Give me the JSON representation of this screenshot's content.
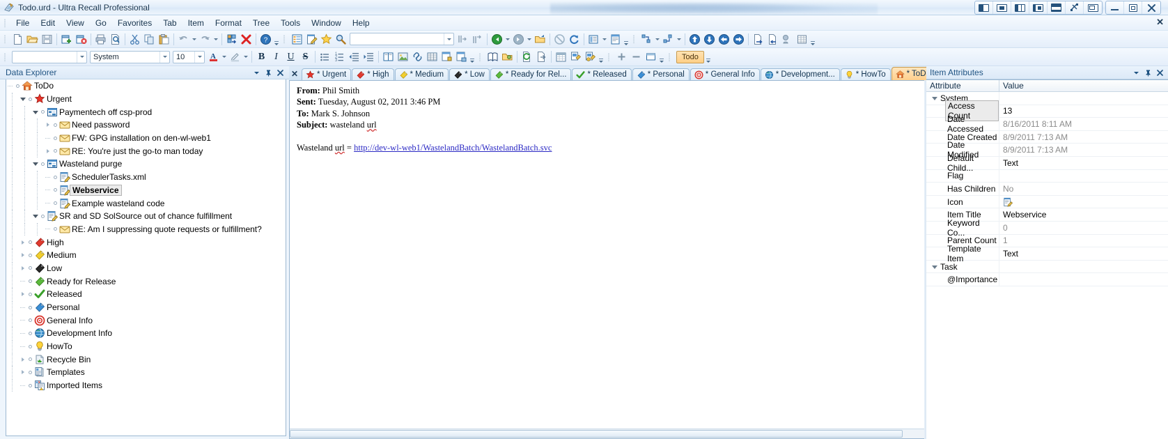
{
  "window": {
    "title": "Todo.urd - Ultra Recall Professional",
    "app_icon": "notebook-icon",
    "layout_buttons": [
      "layout-left-icon",
      "layout-center-icon",
      "layout-split3-icon",
      "layout-split2-icon",
      "layout-stack-icon",
      "layout-free-icon",
      "layout-float-icon"
    ],
    "minimize": "minimize-icon",
    "restore": "restore-icon",
    "close": "close-icon"
  },
  "menu": {
    "items": [
      "File",
      "Edit",
      "View",
      "Go",
      "Favorites",
      "Tab",
      "Item",
      "Format",
      "Tree",
      "Tools",
      "Window",
      "Help"
    ],
    "close_label": "✕"
  },
  "toolbar_main": {
    "groups": [
      [
        "new-document-icon",
        "open-folder-icon",
        "save-icon"
      ],
      [
        "new-window-icon",
        "close-window-icon"
      ],
      [
        "print-icon",
        "print-preview-icon"
      ],
      [
        "cut-icon",
        "copy-icon",
        "paste-icon"
      ],
      [
        "undo-icon",
        "redo-icon"
      ],
      [
        "insert-item-icon",
        "delete-icon"
      ],
      [
        "help-icon"
      ]
    ],
    "group2": [
      "outline-icon",
      "edit-note-icon",
      "favorite-star-icon",
      "search-magnifier-icon"
    ],
    "search_value": "",
    "nav": [
      "find-prev-icon",
      "find-next-icon",
      "back-arrow-icon",
      "forward-arrow-icon",
      "open-link-icon",
      "stop-icon",
      "refresh-icon",
      "view-pane-icon",
      "report-icon"
    ],
    "group4": [
      "indent-out-icon",
      "indent-in-icon",
      "move-up-icon",
      "move-down-icon",
      "move-left-icon",
      "move-right-icon",
      "export-icon",
      "import-icon"
    ]
  },
  "toolbar_format": {
    "style_value": "",
    "font_value": "System",
    "size_value": "10",
    "buttons": [
      "font-color-icon",
      "highlight-icon",
      "bold-icon",
      "italic-icon",
      "underline-icon",
      "strikethrough-icon",
      "bullet-list-icon",
      "numbered-list-icon",
      "indent-decrease-icon",
      "indent-increase-icon",
      "align-left-icon"
    ],
    "group2": [
      "page-view-icon",
      "insert-image-icon",
      "insert-link-icon",
      "table-icon",
      "insert-object-icon",
      "insert-field-icon"
    ],
    "group3": [
      "dictionary-icon",
      "folder-open-icon",
      "sync-icon",
      "copy-page-icon",
      "calendar-icon",
      "flag-add-icon",
      "flag-remove-icon"
    ],
    "group4": [
      "zoom-in-icon",
      "zoom-out-icon",
      "window-icon"
    ],
    "todo_chip": "Todo"
  },
  "explorer": {
    "caption": "Data Explorer",
    "menu_icon": "chevron-down-icon",
    "pin_icon": "pushpin-icon",
    "close_icon": "close-icon",
    "tree": [
      {
        "label": "ToDo",
        "icon": "home-icon",
        "indent": 0,
        "expander": "none",
        "plug": true
      },
      {
        "label": "Urgent",
        "icon": "red-star-icon",
        "indent": 1,
        "expander": "open",
        "plug": true
      },
      {
        "label": "Paymentech off csp-prod",
        "icon": "blue-grid-icon",
        "indent": 2,
        "expander": "open",
        "plug": true
      },
      {
        "label": "Need password",
        "icon": "envelope-icon",
        "indent": 3,
        "expander": "closed",
        "plug": true
      },
      {
        "label": "FW: GPG installation on den-wl-web1",
        "icon": "envelope-icon",
        "indent": 3,
        "expander": "none",
        "plug": true
      },
      {
        "label": "RE: You're just the go-to man today",
        "icon": "envelope-icon",
        "indent": 3,
        "expander": "closed",
        "plug": true
      },
      {
        "label": "Wasteland purge",
        "icon": "blue-grid-icon",
        "indent": 2,
        "expander": "open",
        "plug": true
      },
      {
        "label": "SchedulerTasks.xml",
        "icon": "note-edit-icon",
        "indent": 3,
        "expander": "none",
        "plug": true
      },
      {
        "label": "Webservice",
        "icon": "note-edit-icon",
        "indent": 3,
        "expander": "none",
        "plug": true,
        "selected": true
      },
      {
        "label": "Example wasteland code",
        "icon": "note-edit-icon",
        "indent": 3,
        "expander": "none",
        "plug": true
      },
      {
        "label": "SR and SD SolSource out of chance fulfillment",
        "icon": "note-edit-icon",
        "indent": 2,
        "expander": "open",
        "plug": true
      },
      {
        "label": "RE: Am I suppressing quote requests or fulfillment?",
        "icon": "envelope-icon",
        "indent": 3,
        "expander": "none",
        "plug": true
      },
      {
        "label": "High",
        "icon": "red-tag-icon",
        "indent": 1,
        "expander": "closed",
        "plug": true
      },
      {
        "label": "Medium",
        "icon": "yellow-tag-icon",
        "indent": 1,
        "expander": "closed",
        "plug": true
      },
      {
        "label": "Low",
        "icon": "black-tag-icon",
        "indent": 1,
        "expander": "closed",
        "plug": true
      },
      {
        "label": "Ready for Release",
        "icon": "green-tag-icon",
        "indent": 1,
        "expander": "none",
        "plug": true
      },
      {
        "label": "Released",
        "icon": "green-check-icon",
        "indent": 1,
        "expander": "closed",
        "plug": true
      },
      {
        "label": "Personal",
        "icon": "blue-tag-icon",
        "indent": 1,
        "expander": "none",
        "plug": true
      },
      {
        "label": "General Info",
        "icon": "target-icon",
        "indent": 1,
        "expander": "none",
        "plug": true
      },
      {
        "label": "Development Info",
        "icon": "globe-icon",
        "indent": 1,
        "expander": "none",
        "plug": true
      },
      {
        "label": "HowTo",
        "icon": "lightbulb-icon",
        "indent": 1,
        "expander": "none",
        "plug": true
      },
      {
        "label": "Recycle Bin",
        "icon": "recycle-bin-icon",
        "indent": 1,
        "expander": "closed",
        "plug": true
      },
      {
        "label": "Templates",
        "icon": "templates-icon",
        "indent": 1,
        "expander": "closed",
        "plug": true
      },
      {
        "label": "Imported Items",
        "icon": "imported-items-icon",
        "indent": 1,
        "expander": "none",
        "plug": true
      }
    ]
  },
  "tabs": {
    "close_label": "✕",
    "items": [
      {
        "label": "* Urgent",
        "icon": "red-star-icon",
        "active": false
      },
      {
        "label": "* High",
        "icon": "red-tag-icon",
        "active": false
      },
      {
        "label": "* Medium",
        "icon": "yellow-tag-icon",
        "active": false
      },
      {
        "label": "* Low",
        "icon": "black-tag-icon",
        "active": false
      },
      {
        "label": "* Ready for Rel...",
        "icon": "green-tag-icon",
        "active": false
      },
      {
        "label": "* Released",
        "icon": "green-check-icon",
        "active": false
      },
      {
        "label": "* Personal",
        "icon": "blue-tag-icon",
        "active": false
      },
      {
        "label": "* General Info",
        "icon": "target-icon",
        "active": false
      },
      {
        "label": "* Development...",
        "icon": "globe-icon",
        "active": false
      },
      {
        "label": "* HowTo",
        "icon": "lightbulb-icon",
        "active": false
      },
      {
        "label": "* ToDo",
        "icon": "home-icon",
        "active": true
      }
    ]
  },
  "editor": {
    "from_label": "From:",
    "from_value": "Phil Smith",
    "sent_label": "Sent:",
    "sent_value": "Tuesday, August 02, 2011 3:46 PM",
    "to_label": "To:",
    "to_value": "Mark S. Johnson",
    "subject_label": "Subject:",
    "subject_value": "wasteland url",
    "body_prefix": "Wasteland url = ",
    "body_link": "http://dev-wl-web1/WastelandBatch/WastelandBatch.svc"
  },
  "attributes": {
    "caption": "Item Attributes",
    "menu_icon": "chevron-down-icon",
    "pin_icon": "pushpin-icon",
    "close_icon": "close-icon",
    "col_attribute": "Attribute",
    "col_value": "Value",
    "rows": [
      {
        "type": "group",
        "key": "System",
        "value": ""
      },
      {
        "type": "row",
        "key": "Access Count",
        "value": "13",
        "selected": true,
        "dim": false
      },
      {
        "type": "row",
        "key": "Date Accessed",
        "value": "8/16/2011 8:11 AM",
        "dim": true
      },
      {
        "type": "row",
        "key": "Date Created",
        "value": "8/9/2011 7:13 AM",
        "dim": true
      },
      {
        "type": "row",
        "key": "Date Modified",
        "value": "8/9/2011 7:13 AM",
        "dim": true
      },
      {
        "type": "row",
        "key": "Default Child...",
        "value": "Text",
        "dim": false
      },
      {
        "type": "row",
        "key": "Flag",
        "value": "",
        "dim": false
      },
      {
        "type": "row",
        "key": "Has Children",
        "value": "No",
        "dim": true
      },
      {
        "type": "row",
        "key": "Icon",
        "value": "",
        "icon": "note-edit-icon",
        "dim": false
      },
      {
        "type": "row",
        "key": "Item Title",
        "value": "Webservice",
        "dim": false
      },
      {
        "type": "row",
        "key": "Keyword Co...",
        "value": "0",
        "dim": true
      },
      {
        "type": "row",
        "key": "Parent Count",
        "value": "1",
        "dim": true
      },
      {
        "type": "row",
        "key": "Template Item",
        "value": "Text",
        "dim": false
      },
      {
        "type": "group",
        "key": "Task",
        "value": ""
      },
      {
        "type": "row",
        "key": "@Importance",
        "value": "",
        "dim": false
      }
    ]
  },
  "colors": {
    "accent": "#ffcf8c",
    "link": "#2b29c4",
    "caption_text": "#1f5382",
    "chrome": "#dfeaf7"
  }
}
